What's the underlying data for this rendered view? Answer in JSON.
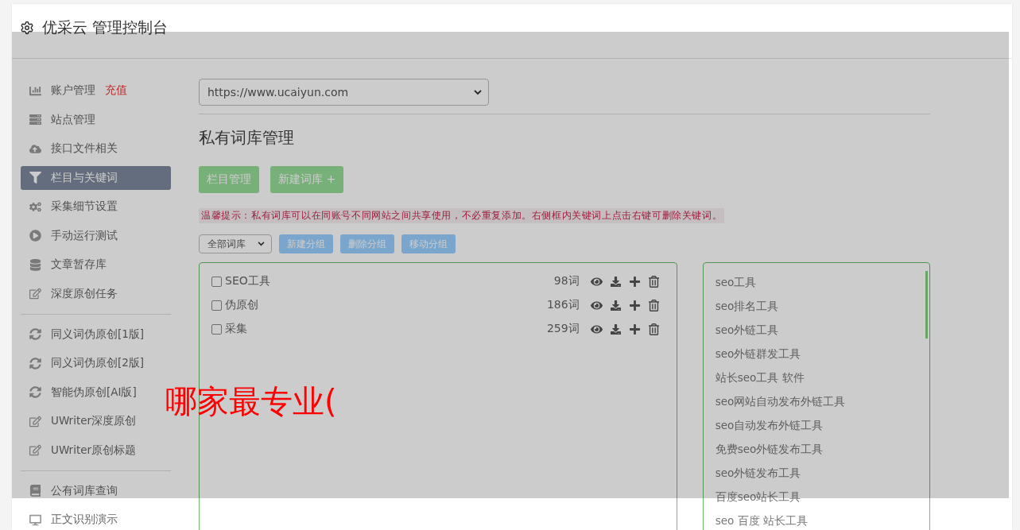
{
  "header": {
    "title": "优采云 管理控制台"
  },
  "sidebar": {
    "sections": [
      {
        "items": [
          {
            "label": "账户管理",
            "badge": "充值",
            "selected": false
          },
          {
            "label": "站点管理",
            "selected": false
          },
          {
            "label": "接口文件相关",
            "selected": false
          },
          {
            "label": "栏目与关键词",
            "selected": true
          },
          {
            "label": "采集细节设置",
            "selected": false
          },
          {
            "label": "手动运行测试",
            "selected": false
          },
          {
            "label": "文章暂存库",
            "selected": false
          },
          {
            "label": "深度原创任务",
            "selected": false
          }
        ]
      },
      {
        "items": [
          {
            "label": "同义词伪原创[1版]",
            "selected": false
          },
          {
            "label": "同义词伪原创[2版]",
            "selected": false
          },
          {
            "label": "智能伪原创[AI版]",
            "selected": false
          },
          {
            "label": "UWriter深度原创",
            "selected": false
          },
          {
            "label": "UWriter原创标题",
            "selected": false
          }
        ]
      },
      {
        "items": [
          {
            "label": "公有词库查询",
            "selected": false
          },
          {
            "label": "正文识别演示",
            "selected": false
          }
        ]
      }
    ]
  },
  "site_select": {
    "value": "https://www.ucaiyun.com"
  },
  "page_title": "私有词库管理",
  "action_buttons": [
    "栏目管理",
    "新建词库 +"
  ],
  "tip": "温馨提示：私有词库可以在同账号不同网站之间共享使用，不必重复添加。右侧框内关键词上点击右键可删除关键词。",
  "group_select": {
    "value": "全部词库"
  },
  "group_buttons": [
    "新建分组",
    "删除分组",
    "移动分组"
  ],
  "libraries": [
    {
      "name": "SEO工具",
      "count": "98词",
      "checked": false
    },
    {
      "name": "伪原创",
      "count": "186词",
      "checked": false
    },
    {
      "name": "采集",
      "count": "259词",
      "checked": false
    }
  ],
  "keywords": [
    "seo工具",
    "seo排名工具",
    "seo外链工具",
    "seo外链群发工具",
    "站长seo工具 软件",
    "seo网站自动发布外链工具",
    "seo自动发布外链工具",
    "免费seo外链发布工具",
    "seo外链发布工具",
    "百度seo站长工具",
    "seo 百度 站长工具"
  ],
  "overlay_caption": "哪家最专业("
}
